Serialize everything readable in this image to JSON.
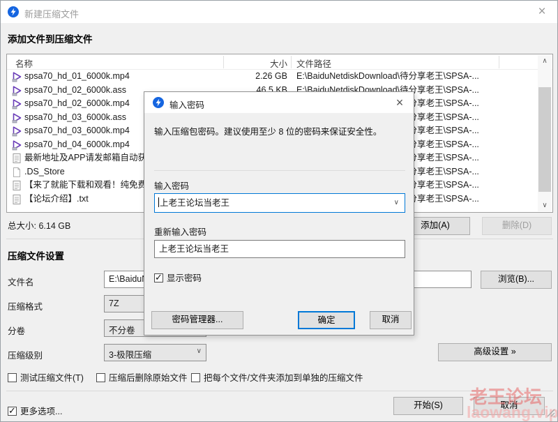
{
  "window": {
    "title": "新建压缩文件",
    "close_glyph": "×"
  },
  "add_files": {
    "section_title": "添加文件到压缩文件",
    "columns": {
      "name": "名称",
      "size": "大小",
      "path": "文件路径"
    },
    "files": [
      {
        "name": "spsa70_hd_01_6000k.mp4",
        "type": "video",
        "size": "2.26 GB",
        "path": "E:\\BaiduNetdiskDownload\\待分享老王\\SPSA-..."
      },
      {
        "name": "spsa70_hd_02_6000k.ass",
        "type": "video",
        "size": "46.5 KB",
        "path": "E:\\BaiduNetdiskDownload\\待分享老王\\SPSA-..."
      },
      {
        "name": "spsa70_hd_02_6000k.mp4",
        "type": "video",
        "size": "",
        "path": "E:\\BaiduNetdiskDownload\\待分享老王\\SPSA-..."
      },
      {
        "name": "spsa70_hd_03_6000k.ass",
        "type": "video",
        "size": "",
        "path": "E:\\BaiduNetdiskDownload\\待分享老王\\SPSA-..."
      },
      {
        "name": "spsa70_hd_03_6000k.mp4",
        "type": "video",
        "size": "",
        "path": "E:\\BaiduNetdiskDownload\\待分享老王\\SPSA-..."
      },
      {
        "name": "spsa70_hd_04_6000k.mp4",
        "type": "video",
        "size": "",
        "path": "E:\\BaiduNetdiskDownload\\待分享老王\\SPSA-..."
      },
      {
        "name": "最新地址及APP请发邮箱自动获",
        "type": "text",
        "size": "",
        "path": "E:\\BaiduNetdiskDownload\\待分享老王\\SPSA-..."
      },
      {
        "name": ".DS_Store",
        "type": "blank",
        "size": "",
        "path": "E:\\BaiduNetdiskDownload\\待分享老王\\SPSA-..."
      },
      {
        "name": "【来了就能下载和观看！纯免费",
        "type": "text",
        "size": "",
        "path": "E:\\BaiduNetdiskDownload\\待分享老王\\SPSA-..."
      },
      {
        "name": "【论坛介绍】.txt",
        "type": "text",
        "size": "",
        "path": "E:\\BaiduNetdiskDownload\\待分享老王\\SPSA-..."
      }
    ],
    "total": "总大小: 6.14 GB",
    "add_label": "添加(A)",
    "delete_label": "删除(D)"
  },
  "settings": {
    "section_title": "压缩文件设置",
    "filename_label": "文件名",
    "filename_value": "E:\\BaiduN",
    "browse_label": "浏览(B)...",
    "format_label": "压缩格式",
    "format_value": "7Z",
    "volume_label": "分卷",
    "volume_value": "不分卷",
    "level_label": "压缩级别",
    "level_value": "3-极限压缩",
    "advanced_label": "高级设置 »",
    "checkboxes": [
      {
        "label": "测试压缩文件(T)",
        "checked": false
      },
      {
        "label": "压缩后删除原始文件",
        "checked": false
      },
      {
        "label": "把每个文件/文件夹添加到单独的压缩文件",
        "checked": false
      }
    ]
  },
  "footer": {
    "more_options": "更多选项...",
    "more_checked": true,
    "start": "开始(S)",
    "cancel": "取消"
  },
  "password_dialog": {
    "title": "输入密码",
    "close_glyph": "×",
    "message": "输入压缩包密码。建议使用至少 8 位的密码来保证安全性。",
    "password_label": "输入密码",
    "password_value": "上老王论坛当老王",
    "confirm_label": "重新输入密码",
    "confirm_value": "上老王论坛当老王",
    "show_password_label": "显示密码",
    "show_password_checked": true,
    "manager_button": "密码管理器...",
    "ok_button": "确定",
    "cancel_button": "取消"
  },
  "watermark": {
    "line1": "老王论坛",
    "line2": "laowang.vip",
    "color1": "rgba(231,103,103,0.55)",
    "color2": "rgba(243,166,166,0.6)"
  }
}
